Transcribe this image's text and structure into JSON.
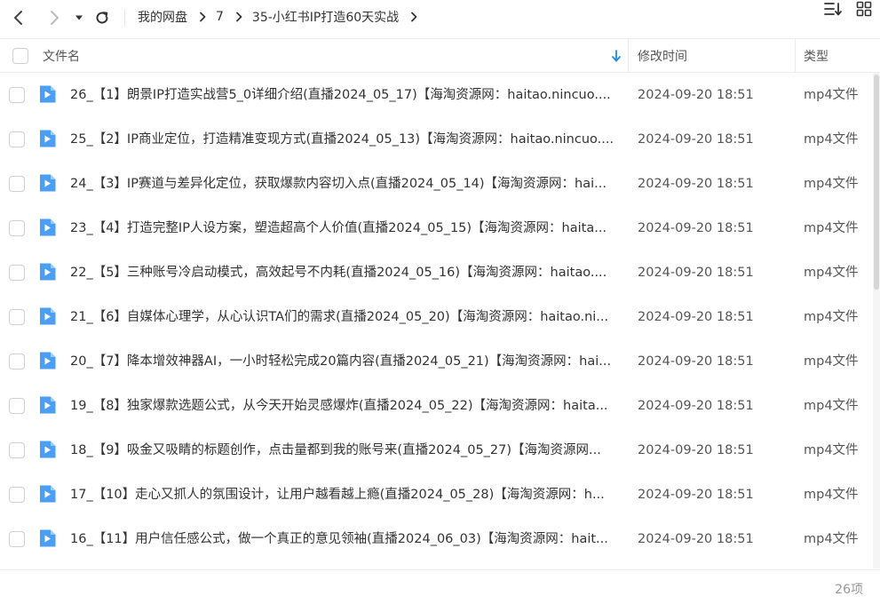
{
  "toolbar": {
    "back_icon": "chevron-left-icon",
    "forward_icon": "chevron-right-icon",
    "history_icon": "caret-down-icon",
    "refresh_icon": "refresh-icon",
    "sort_icon": "sort-lines-icon",
    "view_icon": "grid-view-icon"
  },
  "breadcrumb": [
    {
      "label": "我的网盘"
    },
    {
      "label": "7"
    },
    {
      "label": "35-小红书IP打造60天实战"
    }
  ],
  "columns": {
    "name": "文件名",
    "modified": "修改时间",
    "type": "类型"
  },
  "colors": {
    "accent": "#1e8be8",
    "icon_blue": "#4a9ff5"
  },
  "files": [
    {
      "name": "26_【1】朗景IP打造实战营5_0详细介绍(直播2024_05_17)【海淘资源网：haitao.nincuo....",
      "modified": "2024-09-20 18:51",
      "type": "mp4文件"
    },
    {
      "name": "25_【2】IP商业定位，打造精准变现方式(直播2024_05_13)【海淘资源网：haitao.nincuo....",
      "modified": "2024-09-20 18:51",
      "type": "mp4文件"
    },
    {
      "name": "24_【3】IP赛道与差异化定位，获取爆款内容切入点(直播2024_05_14)【海淘资源网：hai...",
      "modified": "2024-09-20 18:51",
      "type": "mp4文件"
    },
    {
      "name": "23_【4】打造完整IP人设方案，塑造超高个人价值(直播2024_05_15)【海淘资源网：haita...",
      "modified": "2024-09-20 18:51",
      "type": "mp4文件"
    },
    {
      "name": "22_【5】三种账号冷启动模式，高效起号不内耗(直播2024_05_16)【海淘资源网：haitao....",
      "modified": "2024-09-20 18:51",
      "type": "mp4文件"
    },
    {
      "name": "21_【6】自媒体心理学，从心认识TA们的需求(直播2024_05_20)【海淘资源网：haitao.ni...",
      "modified": "2024-09-20 18:51",
      "type": "mp4文件"
    },
    {
      "name": "20_【7】降本增效神器AI，一小时轻松完成20篇内容(直播2024_05_21)【海淘资源网：hai...",
      "modified": "2024-09-20 18:51",
      "type": "mp4文件"
    },
    {
      "name": "19_【8】独家爆款选题公式，从今天开始灵感爆炸(直播2024_05_22)【海淘资源网：haita...",
      "modified": "2024-09-20 18:51",
      "type": "mp4文件"
    },
    {
      "name": "18_【9】吸金又吸睛的标题创作，点击量都到我的账号来(直播2024_05_27)【海淘资源网...",
      "modified": "2024-09-20 18:51",
      "type": "mp4文件"
    },
    {
      "name": "17_【10】走心又抓人的氛围设计，让用户越看越上瘾(直播2024_05_28)【海淘资源网：h...",
      "modified": "2024-09-20 18:51",
      "type": "mp4文件"
    },
    {
      "name": "16_【11】用户信任感公式，做一个真正的意见领袖(直播2024_06_03)【海淘资源网：hait...",
      "modified": "2024-09-20 18:51",
      "type": "mp4文件"
    }
  ],
  "footer": {
    "item_count": "26项"
  }
}
